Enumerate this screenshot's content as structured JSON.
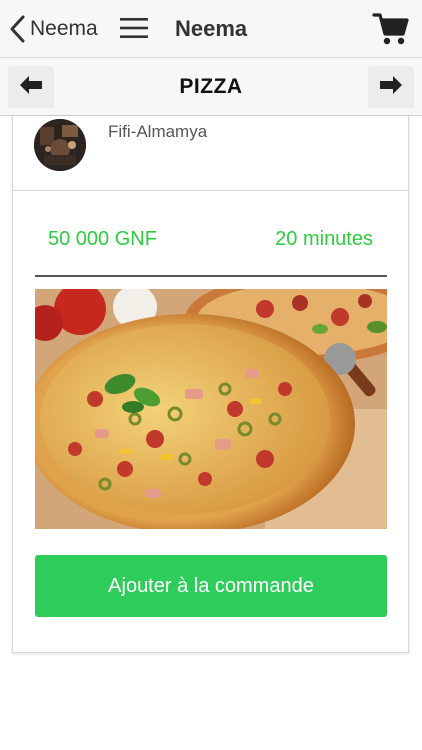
{
  "topbar": {
    "back_label": "Neema",
    "title": "Neema",
    "icons": [
      "chevron-left-icon",
      "hamburger-menu-icon",
      "shopping-cart-icon"
    ]
  },
  "subbar": {
    "title": "PIZZA",
    "icons": [
      "arrow-left-icon",
      "arrow-right-icon"
    ]
  },
  "card": {
    "author": "Fifi-Almamya",
    "price": "50 000 GNF",
    "duration": "20 minutes",
    "add_button_label": "Ajouter à la commande"
  },
  "colors": {
    "accent_green": "#2ecc5a",
    "text_green": "#2ecc40",
    "bar_bg": "#f7f7f7"
  }
}
